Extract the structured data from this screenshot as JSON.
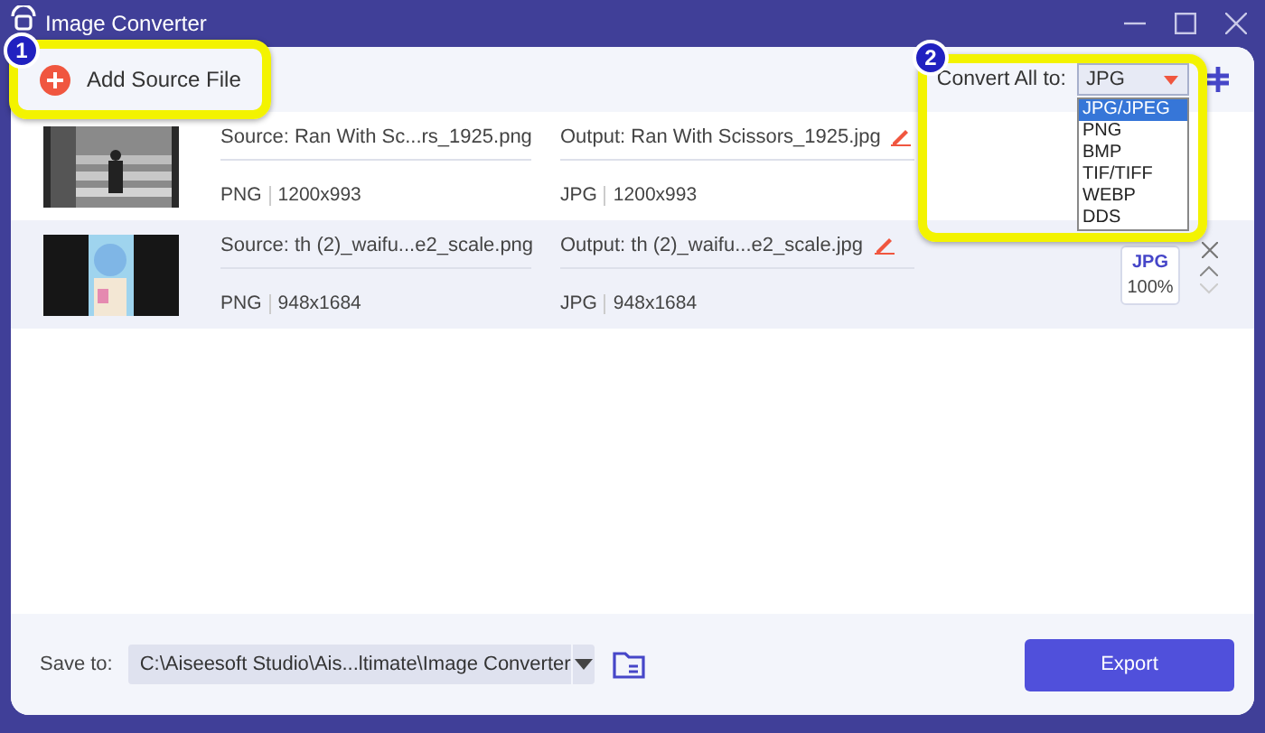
{
  "window": {
    "title": "Image Converter"
  },
  "toolbar": {
    "add_button": "Add Source File",
    "convert_label": "Convert All to:",
    "convert_value": "JPG"
  },
  "format_menu": [
    {
      "label": "JPG/JPEG",
      "selected": true
    },
    {
      "label": "PNG",
      "selected": false
    },
    {
      "label": "BMP",
      "selected": false
    },
    {
      "label": "TIF/TIFF",
      "selected": false
    },
    {
      "label": "WEBP",
      "selected": false
    },
    {
      "label": "DDS",
      "selected": false
    }
  ],
  "files": [
    {
      "source": "Source: Ran With Sc...rs_1925.png",
      "source_format": "PNG",
      "source_size": "1200x993",
      "output": "Output: Ran With Scissors_1925.jpg",
      "output_format": "JPG",
      "output_size": "1200x993",
      "selected": false
    },
    {
      "source": "Source: th (2)_waifu...e2_scale.png",
      "source_format": "PNG",
      "source_size": "948x1684",
      "output": "Output: th (2)_waifu...e2_scale.jpg",
      "output_format": "JPG",
      "output_size": "948x1684",
      "selected": true,
      "badge": {
        "format": "JPG",
        "quality": "100%"
      }
    }
  ],
  "footer": {
    "save_label": "Save to:",
    "path": "C:\\Aiseesoft Studio\\Ais...ltimate\\Image Converter",
    "export_button": "Export"
  },
  "callouts": [
    {
      "number": "1"
    },
    {
      "number": "2"
    }
  ]
}
